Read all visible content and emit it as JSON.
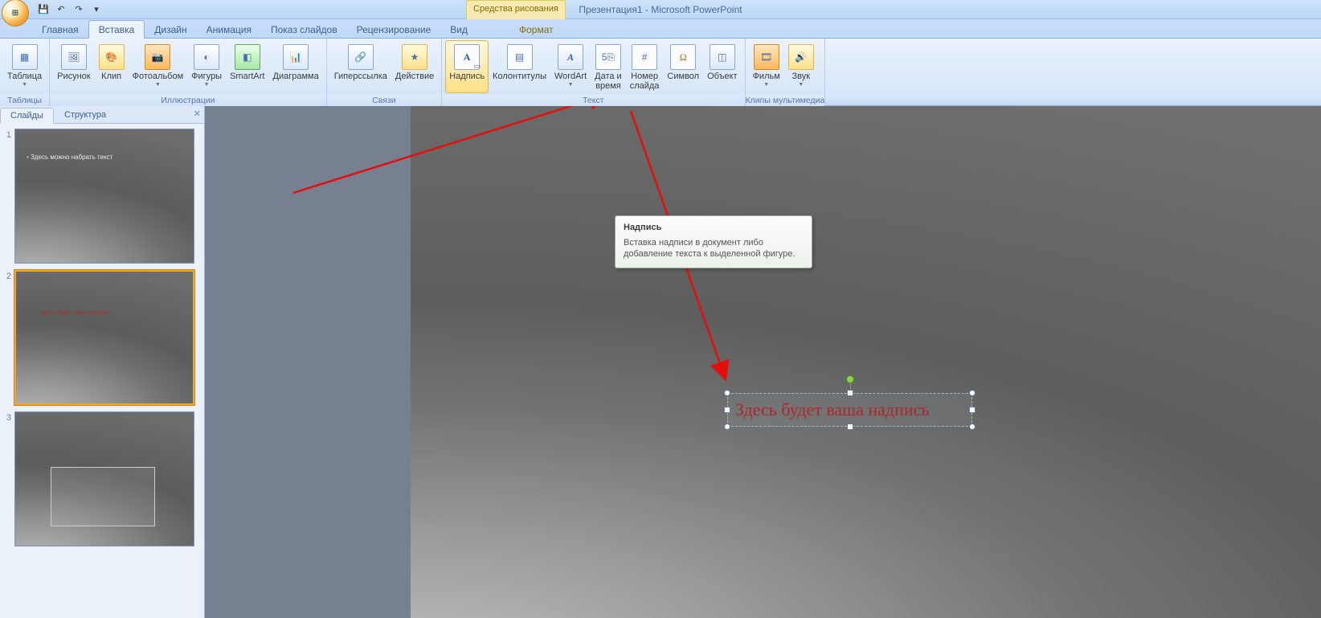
{
  "title": "Презентация1 - Microsoft PowerPoint",
  "context_tab_group": "Средства рисования",
  "qat": {
    "save": "💾",
    "undo": "↶",
    "redo": "↷"
  },
  "tabs": [
    {
      "id": "home",
      "label": "Главная"
    },
    {
      "id": "insert",
      "label": "Вставка",
      "active": true
    },
    {
      "id": "design",
      "label": "Дизайн"
    },
    {
      "id": "anim",
      "label": "Анимация"
    },
    {
      "id": "show",
      "label": "Показ слайдов"
    },
    {
      "id": "review",
      "label": "Рецензирование"
    },
    {
      "id": "view",
      "label": "Вид"
    },
    {
      "id": "format",
      "label": "Формат",
      "context": true
    }
  ],
  "ribbon": {
    "groups": [
      {
        "id": "tables",
        "label": "Таблицы",
        "buttons": [
          {
            "id": "table",
            "label": "Таблица",
            "dd": true
          }
        ]
      },
      {
        "id": "illustr",
        "label": "Иллюстрации",
        "buttons": [
          {
            "id": "picture",
            "label": "Рисунок"
          },
          {
            "id": "clip",
            "label": "Клип"
          },
          {
            "id": "album",
            "label": "Фотоальбом",
            "dd": true
          },
          {
            "id": "shapes",
            "label": "Фигуры",
            "dd": true
          },
          {
            "id": "smartart",
            "label": "SmartArt"
          },
          {
            "id": "chart",
            "label": "Диаграмма"
          }
        ]
      },
      {
        "id": "links",
        "label": "Связи",
        "buttons": [
          {
            "id": "hyperlink",
            "label": "Гиперссылка"
          },
          {
            "id": "action",
            "label": "Действие"
          }
        ]
      },
      {
        "id": "text",
        "label": "Текст",
        "buttons": [
          {
            "id": "textbox",
            "label": "Надпись",
            "selected": true
          },
          {
            "id": "headfoot",
            "label": "Колонтитулы"
          },
          {
            "id": "wordart",
            "label": "WordArt",
            "dd": true
          },
          {
            "id": "datetime",
            "label": "Дата и\nвремя"
          },
          {
            "id": "slidenum",
            "label": "Номер\nслайда"
          },
          {
            "id": "symbol",
            "label": "Символ"
          },
          {
            "id": "object",
            "label": "Объект"
          }
        ]
      },
      {
        "id": "media",
        "label": "Клипы мультимедиа",
        "buttons": [
          {
            "id": "movie",
            "label": "Фильм",
            "dd": true
          },
          {
            "id": "sound",
            "label": "Звук",
            "dd": true
          }
        ]
      }
    ]
  },
  "panel": {
    "tab_slides": "Слайды",
    "tab_outline": "Структура",
    "thumbs": [
      {
        "n": "1",
        "text": "Здесь можно набрать текст"
      },
      {
        "n": "2",
        "text2": "Здесь будет ваша надпись",
        "selected": true
      },
      {
        "n": "3",
        "box": true
      }
    ]
  },
  "tooltip": {
    "title": "Надпись",
    "body": "Вставка надписи в документ либо добавление текста к выделенной фигуре."
  },
  "slide_textbox": "Здесь будет ваша надпись"
}
